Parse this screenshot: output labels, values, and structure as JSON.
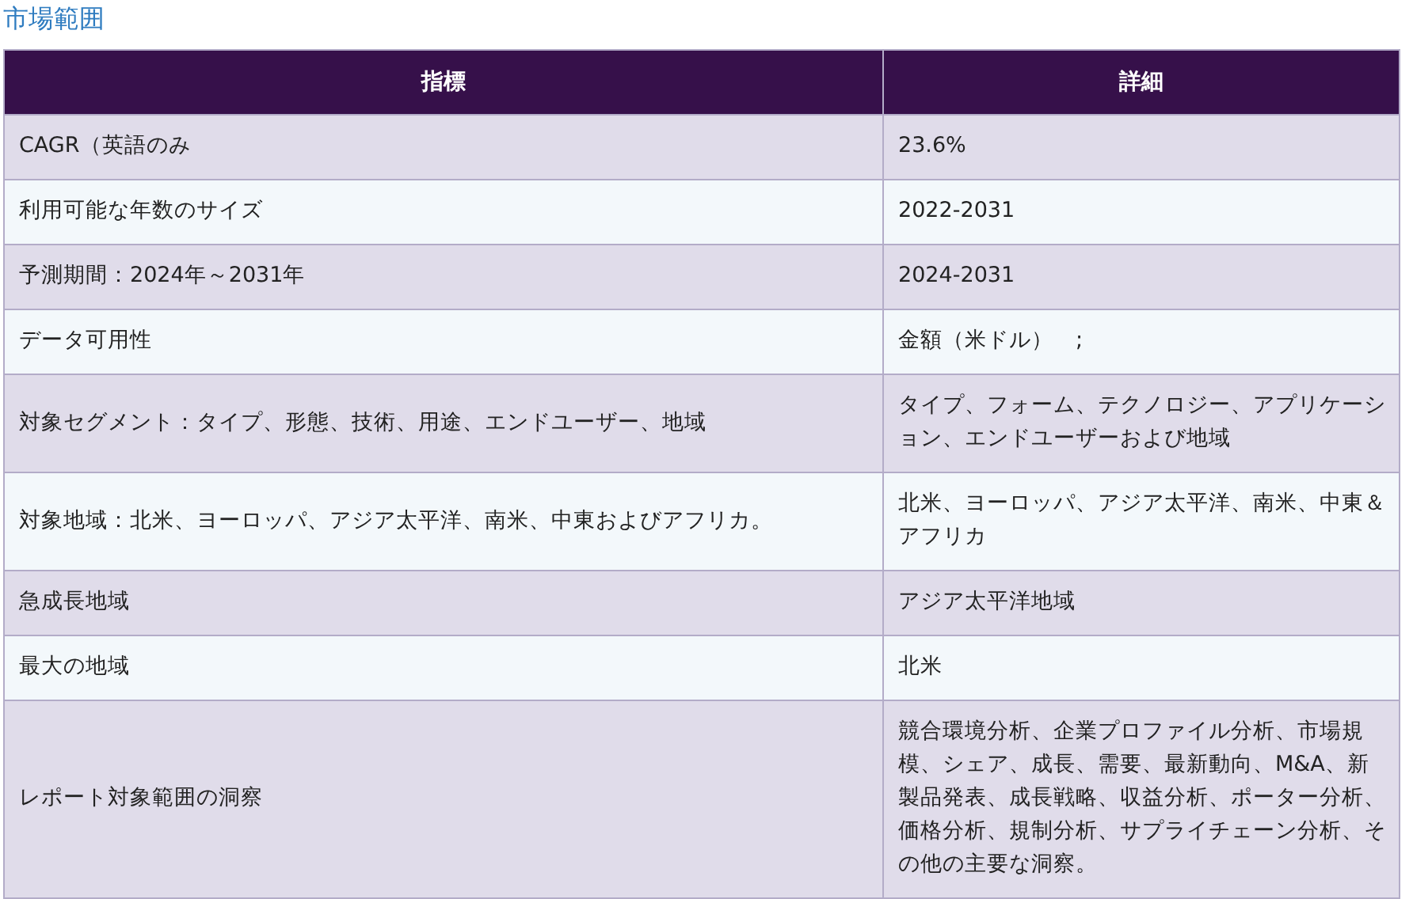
{
  "title": "市場範囲",
  "table": {
    "columns": [
      "指標",
      "詳細"
    ],
    "rows": [
      [
        "CAGR（英語のみ",
        "23.6%"
      ],
      [
        "利用可能な年数のサイズ",
        "2022-2031"
      ],
      [
        "予測期間：2024年～2031年",
        "2024-2031"
      ],
      [
        "データ可用性",
        "金額（米ドル）　;"
      ],
      [
        "対象セグメント：タイプ、形態、技術、用途、エンドユーザー、地域",
        "タイプ、フォーム、テクノロジー、アプリケーション、エンドユーザーおよび地域"
      ],
      [
        "対象地域：北米、ヨーロッパ、アジア太平洋、南米、中東およびアフリカ。",
        "北米、ヨーロッパ、アジア太平洋、南米、中東＆アフリカ"
      ],
      [
        "急成長地域",
        "アジア太平洋地域"
      ],
      [
        "最大の地域",
        "北米"
      ],
      [
        "レポート対象範囲の洞察",
        "競合環境分析、企業プロファイル分析、市場規模、シェア、成長、需要、最新動向、M&A、新製品発表、成長戦略、収益分析、ポーター分析、価格分析、規制分析、サプライチェーン分析、その他の主要な洞察。"
      ]
    ]
  }
}
